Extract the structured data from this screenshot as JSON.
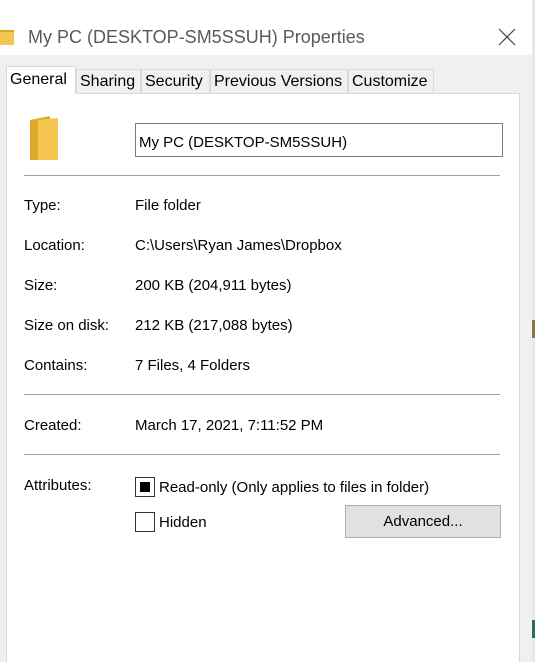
{
  "window": {
    "title": "My PC (DESKTOP-SM5SSUH) Properties"
  },
  "tabs": [
    {
      "label": "General"
    },
    {
      "label": "Sharing"
    },
    {
      "label": "Security"
    },
    {
      "label": "Previous Versions"
    },
    {
      "label": "Customize"
    }
  ],
  "active_tab": "General",
  "general": {
    "name_value": "My PC (DESKTOP-SM5SSUH)",
    "rows": [
      {
        "label": "Type:",
        "value": "File folder"
      },
      {
        "label": "Location:",
        "value": "C:\\Users\\Ryan James\\Dropbox"
      },
      {
        "label": "Size:",
        "value": "200 KB (204,911 bytes)"
      },
      {
        "label": "Size on disk:",
        "value": "212 KB (217,088 bytes)"
      },
      {
        "label": "Contains:",
        "value": "7 Files, 4 Folders"
      },
      {
        "label": "Created:",
        "value": "March 17, 2021, 7:11:52 PM"
      }
    ],
    "attributes_label": "Attributes:",
    "readonly_label": "Read-only (Only applies to files in folder)",
    "readonly_state": "indeterminate",
    "hidden_label": "Hidden",
    "hidden_checked": false,
    "advanced_label": "Advanced..."
  },
  "colors": {
    "folder": "#f3c74d",
    "folder_dark": "#dcaa2a"
  },
  "icons": {
    "title": "folder-icon",
    "close": "close-icon",
    "big": "folder-icon"
  }
}
